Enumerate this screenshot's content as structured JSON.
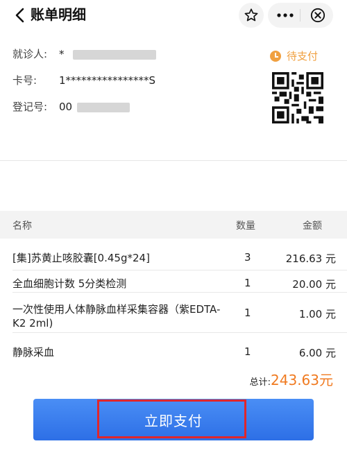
{
  "nav": {
    "title": "账单明细",
    "back_icon": "chevron-left-icon",
    "favorite_icon": "star-icon",
    "more_icon": "more-dots-icon",
    "close_icon": "close-circle-icon"
  },
  "patient": {
    "name_label": "就诊人:",
    "name_value": "*",
    "card_label": "卡号:",
    "card_value": "1****************S",
    "reg_label": "登记号:",
    "reg_value": "00",
    "status": "待支付",
    "status_icon": "clock-icon",
    "status_color": "#f0a040"
  },
  "table": {
    "headers": {
      "name": "名称",
      "qty": "数量",
      "amount": "金额"
    },
    "rows": [
      {
        "name": "[集]苏黄止咳胶囊[0.45g*24]",
        "qty": "3",
        "amount": "216.63 元"
      },
      {
        "name": "全血细胞计数 5分类检测",
        "qty": "1",
        "amount": "20.00 元"
      },
      {
        "name": "一次性使用人体静脉血样采集容器（紫EDTA-K2 2ml)",
        "qty": "1",
        "amount": "1.00 元"
      },
      {
        "name": "静脉采血",
        "qty": "1",
        "amount": "6.00 元"
      }
    ]
  },
  "total": {
    "label": "总计:",
    "value": "243.63元",
    "color": "#f07a20"
  },
  "pay_button": {
    "label": "立即支付",
    "color": "#3a7ef0"
  }
}
